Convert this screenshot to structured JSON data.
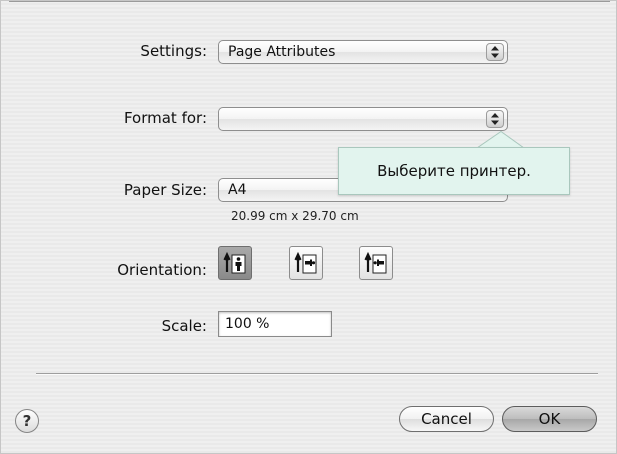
{
  "settings": {
    "label": "Settings:",
    "value": "Page Attributes"
  },
  "format_for": {
    "label": "Format for:",
    "value": ""
  },
  "tooltip": {
    "text": "Выберите принтер."
  },
  "paper_size": {
    "label": "Paper Size:",
    "value": "A4",
    "dimensions": "20.99 cm x 29.70 cm"
  },
  "orientation": {
    "label": "Orientation:",
    "options": [
      {
        "icon": "portrait-orientation-icon",
        "selected": true
      },
      {
        "icon": "landscape-left-orientation-icon",
        "selected": false
      },
      {
        "icon": "landscape-right-orientation-icon",
        "selected": false
      }
    ]
  },
  "scale": {
    "label": "Scale:",
    "value": "100 %"
  },
  "buttons": {
    "help": "?",
    "cancel": "Cancel",
    "ok": "OK"
  },
  "colors": {
    "tooltip_bg": "#e2f4ee",
    "dialog_bg": "#ececec"
  }
}
